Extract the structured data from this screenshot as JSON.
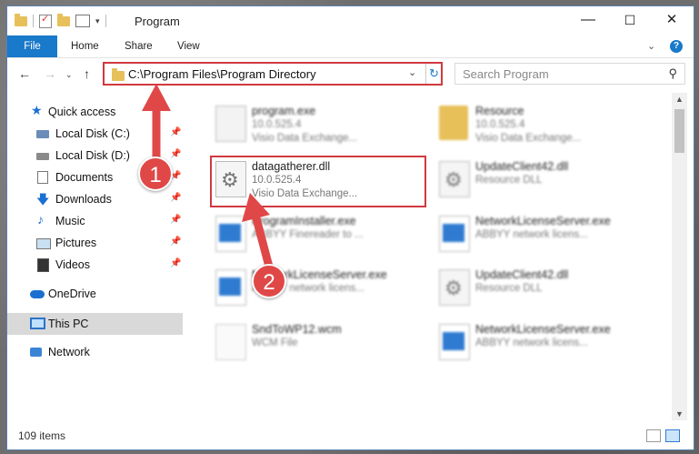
{
  "window": {
    "title": "Program",
    "controls": {
      "minimize": "—",
      "maximize": "☐",
      "close": "✕"
    }
  },
  "ribbon": {
    "tabs": [
      "File",
      "Home",
      "Share",
      "View"
    ],
    "help": "?"
  },
  "address": {
    "path": "C:\\Program Files\\Program Directory",
    "search_placeholder": "Search Program"
  },
  "sidebar": {
    "items": [
      {
        "label": "Quick access",
        "icon": "star-icon"
      },
      {
        "label": "Local Disk (C:)",
        "icon": "drive-icon"
      },
      {
        "label": "Local Disk (D:)",
        "icon": "drive-icon"
      },
      {
        "label": "Documents",
        "icon": "document-icon"
      },
      {
        "label": "Downloads",
        "icon": "download-icon"
      },
      {
        "label": "Music",
        "icon": "music-icon"
      },
      {
        "label": "Pictures",
        "icon": "pictures-icon"
      },
      {
        "label": "Videos",
        "icon": "videos-icon"
      },
      {
        "label": "OneDrive",
        "icon": "cloud-icon"
      },
      {
        "label": "This PC",
        "icon": "computer-icon"
      },
      {
        "label": "Network",
        "icon": "network-icon"
      }
    ]
  },
  "files": [
    {
      "name": "program.exe",
      "version": "10.0.525.4",
      "desc": "Visio Data Exchange..."
    },
    {
      "name": "Resource",
      "version": "10.0.525.4",
      "desc": "Visio Data Exchange..."
    },
    {
      "name": "datagatherer.dll",
      "version": "10.0.525.4",
      "desc": "Visio Data Exchange..."
    },
    {
      "name": "UpdateClient42.dll",
      "version": "Resource DLL",
      "desc": ""
    },
    {
      "name": "ProgramInstaller.exe",
      "version": "ABBYY Finereader to ...",
      "desc": ""
    },
    {
      "name": "NetworkLicenseServer.exe",
      "version": "ABBYY network licens...",
      "desc": ""
    },
    {
      "name": "NetworkLicenseServer.exe",
      "version": "ABBYY network licens...",
      "desc": ""
    },
    {
      "name": "UpdateClient42.dll",
      "version": "Resource DLL",
      "desc": ""
    },
    {
      "name": "SndToWP12.wcm",
      "version": "WCM File",
      "desc": ""
    },
    {
      "name": "NetworkLicenseServer.exe",
      "version": "ABBYY network licens...",
      "desc": ""
    }
  ],
  "status": {
    "count": "109 items"
  },
  "annotations": {
    "step1": "1",
    "step2": "2"
  }
}
